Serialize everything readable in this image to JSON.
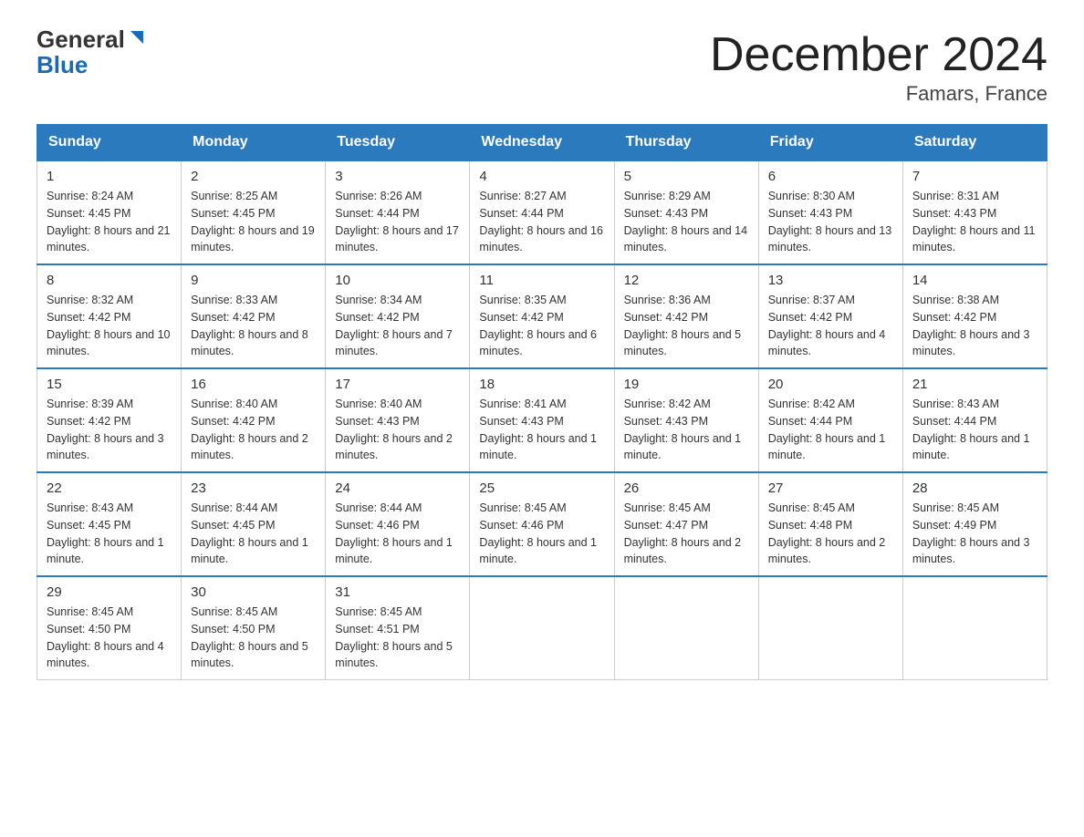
{
  "header": {
    "logo_line1": "General",
    "logo_line2": "Blue",
    "title": "December 2024",
    "subtitle": "Famars, France"
  },
  "weekdays": [
    "Sunday",
    "Monday",
    "Tuesday",
    "Wednesday",
    "Thursday",
    "Friday",
    "Saturday"
  ],
  "weeks": [
    [
      {
        "day": "1",
        "sunrise": "8:24 AM",
        "sunset": "4:45 PM",
        "daylight": "8 hours and 21 minutes."
      },
      {
        "day": "2",
        "sunrise": "8:25 AM",
        "sunset": "4:45 PM",
        "daylight": "8 hours and 19 minutes."
      },
      {
        "day": "3",
        "sunrise": "8:26 AM",
        "sunset": "4:44 PM",
        "daylight": "8 hours and 17 minutes."
      },
      {
        "day": "4",
        "sunrise": "8:27 AM",
        "sunset": "4:44 PM",
        "daylight": "8 hours and 16 minutes."
      },
      {
        "day": "5",
        "sunrise": "8:29 AM",
        "sunset": "4:43 PM",
        "daylight": "8 hours and 14 minutes."
      },
      {
        "day": "6",
        "sunrise": "8:30 AM",
        "sunset": "4:43 PM",
        "daylight": "8 hours and 13 minutes."
      },
      {
        "day": "7",
        "sunrise": "8:31 AM",
        "sunset": "4:43 PM",
        "daylight": "8 hours and 11 minutes."
      }
    ],
    [
      {
        "day": "8",
        "sunrise": "8:32 AM",
        "sunset": "4:42 PM",
        "daylight": "8 hours and 10 minutes."
      },
      {
        "day": "9",
        "sunrise": "8:33 AM",
        "sunset": "4:42 PM",
        "daylight": "8 hours and 8 minutes."
      },
      {
        "day": "10",
        "sunrise": "8:34 AM",
        "sunset": "4:42 PM",
        "daylight": "8 hours and 7 minutes."
      },
      {
        "day": "11",
        "sunrise": "8:35 AM",
        "sunset": "4:42 PM",
        "daylight": "8 hours and 6 minutes."
      },
      {
        "day": "12",
        "sunrise": "8:36 AM",
        "sunset": "4:42 PM",
        "daylight": "8 hours and 5 minutes."
      },
      {
        "day": "13",
        "sunrise": "8:37 AM",
        "sunset": "4:42 PM",
        "daylight": "8 hours and 4 minutes."
      },
      {
        "day": "14",
        "sunrise": "8:38 AM",
        "sunset": "4:42 PM",
        "daylight": "8 hours and 3 minutes."
      }
    ],
    [
      {
        "day": "15",
        "sunrise": "8:39 AM",
        "sunset": "4:42 PM",
        "daylight": "8 hours and 3 minutes."
      },
      {
        "day": "16",
        "sunrise": "8:40 AM",
        "sunset": "4:42 PM",
        "daylight": "8 hours and 2 minutes."
      },
      {
        "day": "17",
        "sunrise": "8:40 AM",
        "sunset": "4:43 PM",
        "daylight": "8 hours and 2 minutes."
      },
      {
        "day": "18",
        "sunrise": "8:41 AM",
        "sunset": "4:43 PM",
        "daylight": "8 hours and 1 minute."
      },
      {
        "day": "19",
        "sunrise": "8:42 AM",
        "sunset": "4:43 PM",
        "daylight": "8 hours and 1 minute."
      },
      {
        "day": "20",
        "sunrise": "8:42 AM",
        "sunset": "4:44 PM",
        "daylight": "8 hours and 1 minute."
      },
      {
        "day": "21",
        "sunrise": "8:43 AM",
        "sunset": "4:44 PM",
        "daylight": "8 hours and 1 minute."
      }
    ],
    [
      {
        "day": "22",
        "sunrise": "8:43 AM",
        "sunset": "4:45 PM",
        "daylight": "8 hours and 1 minute."
      },
      {
        "day": "23",
        "sunrise": "8:44 AM",
        "sunset": "4:45 PM",
        "daylight": "8 hours and 1 minute."
      },
      {
        "day": "24",
        "sunrise": "8:44 AM",
        "sunset": "4:46 PM",
        "daylight": "8 hours and 1 minute."
      },
      {
        "day": "25",
        "sunrise": "8:45 AM",
        "sunset": "4:46 PM",
        "daylight": "8 hours and 1 minute."
      },
      {
        "day": "26",
        "sunrise": "8:45 AM",
        "sunset": "4:47 PM",
        "daylight": "8 hours and 2 minutes."
      },
      {
        "day": "27",
        "sunrise": "8:45 AM",
        "sunset": "4:48 PM",
        "daylight": "8 hours and 2 minutes."
      },
      {
        "day": "28",
        "sunrise": "8:45 AM",
        "sunset": "4:49 PM",
        "daylight": "8 hours and 3 minutes."
      }
    ],
    [
      {
        "day": "29",
        "sunrise": "8:45 AM",
        "sunset": "4:50 PM",
        "daylight": "8 hours and 4 minutes."
      },
      {
        "day": "30",
        "sunrise": "8:45 AM",
        "sunset": "4:50 PM",
        "daylight": "8 hours and 5 minutes."
      },
      {
        "day": "31",
        "sunrise": "8:45 AM",
        "sunset": "4:51 PM",
        "daylight": "8 hours and 5 minutes."
      },
      null,
      null,
      null,
      null
    ]
  ]
}
